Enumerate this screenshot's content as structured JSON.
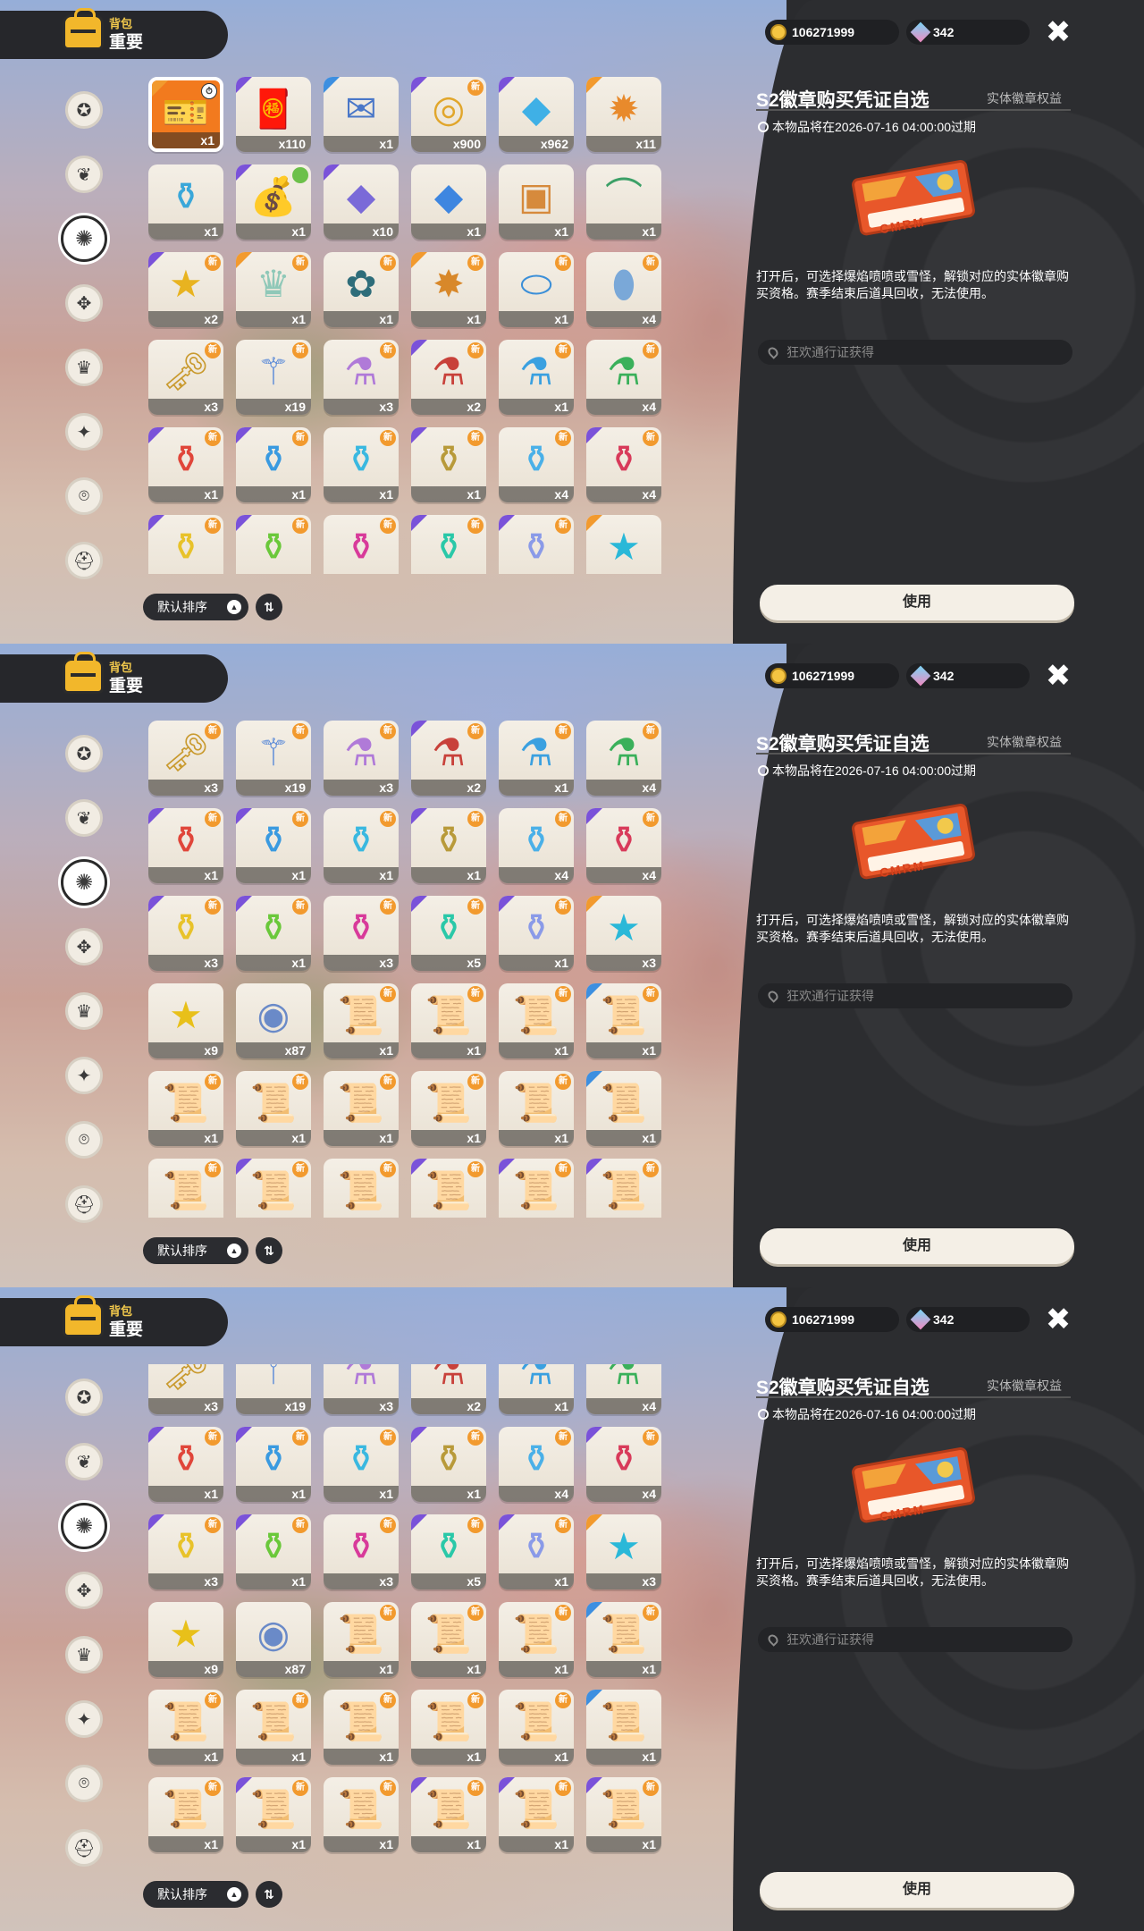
{
  "header": {
    "section": "背包",
    "category": "重要"
  },
  "currency": {
    "coins": "106271999",
    "gems": "342"
  },
  "nav_icons": [
    "star-icon",
    "leaf-icon",
    "badge-icon",
    "feather-icon",
    "crown-icon",
    "ball-icon",
    "acorn-icon",
    "helmet-icon"
  ],
  "nav_active_index": 2,
  "sort": {
    "label": "默认排序",
    "arrow": "▲",
    "order_icon": "⇅"
  },
  "detail": {
    "title": "S2徽章购买凭证自选",
    "tag": "实体徽章权益",
    "expire": "本物品将在2026-07-16 04:00:00过期",
    "ticket_text": "CMRM",
    "description": "打开后，可选择爆焰喷喷或雪怪，解锁对应的实体徽章购买资格。赛季结束后道具回收，无法使用。",
    "source": "狂欢通行证获得",
    "use_label": "使用",
    "close": "✖"
  },
  "new_label": "新",
  "colors": {
    "purple": "#7a52d9",
    "orange": "#f29a2e",
    "blue": "#3d8fe0",
    "accent_selected": "#f27a1e",
    "panel": "#2c2d30"
  },
  "items": [
    {
      "glyph": "🎫",
      "color": "#e0622a",
      "qty": "x1",
      "rarity": "orange",
      "badge": "timer"
    },
    {
      "glyph": "🧧",
      "color": "#c8553a",
      "qty": "x110",
      "rarity": "purple",
      "badge": ""
    },
    {
      "glyph": "✉",
      "color": "#4a77c8",
      "qty": "x1",
      "rarity": "blue",
      "badge": ""
    },
    {
      "glyph": "◎",
      "color": "#e1a62b",
      "qty": "x900",
      "rarity": "purple",
      "badge": "new"
    },
    {
      "glyph": "◆",
      "color": "#3fb0e6",
      "qty": "x962",
      "rarity": "purple",
      "badge": ""
    },
    {
      "glyph": "✹",
      "color": "#e88a2c",
      "qty": "x11",
      "rarity": "orange",
      "badge": ""
    },
    {
      "glyph": "⚱",
      "color": "#3aa7d9",
      "qty": "x1",
      "rarity": "",
      "badge": ""
    },
    {
      "glyph": "💰",
      "color": "#6a4fb3",
      "qty": "x1",
      "rarity": "purple",
      "badge": "green"
    },
    {
      "glyph": "◆",
      "color": "#7a6ad8",
      "qty": "x10",
      "rarity": "purple",
      "badge": ""
    },
    {
      "glyph": "◆",
      "color": "#3e86e0",
      "qty": "x1",
      "rarity": "",
      "badge": ""
    },
    {
      "glyph": "▣",
      "color": "#d68a3c",
      "qty": "x1",
      "rarity": "",
      "badge": ""
    },
    {
      "glyph": "⌒",
      "color": "#3ca067",
      "qty": "x1",
      "rarity": "",
      "badge": ""
    },
    {
      "glyph": "★",
      "color": "#e8b320",
      "qty": "x2",
      "rarity": "purple",
      "badge": "new"
    },
    {
      "glyph": "♛",
      "color": "#8fc8b8",
      "qty": "x1",
      "rarity": "orange",
      "badge": "new"
    },
    {
      "glyph": "✿",
      "color": "#2e6d7a",
      "qty": "x1",
      "rarity": "",
      "badge": "new"
    },
    {
      "glyph": "✸",
      "color": "#d8882a",
      "qty": "x1",
      "rarity": "orange",
      "badge": "new"
    },
    {
      "glyph": "⬭",
      "color": "#3b8fd8",
      "qty": "x1",
      "rarity": "",
      "badge": "new"
    },
    {
      "glyph": "⬮",
      "color": "#7aa8d8",
      "qty": "x4",
      "rarity": "",
      "badge": "new"
    },
    {
      "glyph": "🗝",
      "color": "#c99a2e",
      "qty": "x3",
      "rarity": "",
      "badge": "new"
    },
    {
      "glyph": "⚚",
      "color": "#5a8ad8",
      "qty": "x19",
      "rarity": "",
      "badge": "new"
    },
    {
      "glyph": "⚗",
      "color": "#b07ad8",
      "qty": "x3",
      "rarity": "",
      "badge": "new"
    },
    {
      "glyph": "⚗",
      "color": "#c8413a",
      "qty": "x2",
      "rarity": "purple",
      "badge": "new"
    },
    {
      "glyph": "⚗",
      "color": "#3aa0e0",
      "qty": "x1",
      "rarity": "",
      "badge": "new"
    },
    {
      "glyph": "⚗",
      "color": "#3ab05a",
      "qty": "x4",
      "rarity": "",
      "badge": "new"
    },
    {
      "glyph": "⚱",
      "color": "#e0463a",
      "qty": "x1",
      "rarity": "purple",
      "badge": "new"
    },
    {
      "glyph": "⚱",
      "color": "#3a9ae0",
      "qty": "x1",
      "rarity": "purple",
      "badge": "new"
    },
    {
      "glyph": "⚱",
      "color": "#3ab8e0",
      "qty": "x1",
      "rarity": "",
      "badge": "new"
    },
    {
      "glyph": "⚱",
      "color": "#b89a3a",
      "qty": "x1",
      "rarity": "purple",
      "badge": "new"
    },
    {
      "glyph": "⚱",
      "color": "#4ab0e8",
      "qty": "x4",
      "rarity": "",
      "badge": "new"
    },
    {
      "glyph": "⚱",
      "color": "#d83a5a",
      "qty": "x4",
      "rarity": "purple",
      "badge": "new"
    },
    {
      "glyph": "⚱",
      "color": "#e8c22a",
      "qty": "x3",
      "rarity": "purple",
      "badge": "new"
    },
    {
      "glyph": "⚱",
      "color": "#6ac83a",
      "qty": "x1",
      "rarity": "purple",
      "badge": "new"
    },
    {
      "glyph": "⚱",
      "color": "#d83a9a",
      "qty": "x3",
      "rarity": "",
      "badge": "new"
    },
    {
      "glyph": "⚱",
      "color": "#2ac8a8",
      "qty": "x5",
      "rarity": "purple",
      "badge": "new"
    },
    {
      "glyph": "⚱",
      "color": "#8a9ae8",
      "qty": "x1",
      "rarity": "purple",
      "badge": "new"
    },
    {
      "glyph": "★",
      "color": "#2ab8d8",
      "qty": "x3",
      "rarity": "orange",
      "badge": ""
    },
    {
      "glyph": "★",
      "color": "#e8c01a",
      "qty": "x9",
      "rarity": "",
      "badge": ""
    },
    {
      "glyph": "◉",
      "color": "#6a8ac8",
      "qty": "x87",
      "rarity": "",
      "badge": ""
    },
    {
      "glyph": "📜",
      "color": "#b08a5a",
      "qty": "x1",
      "rarity": "",
      "badge": "new"
    },
    {
      "glyph": "📜",
      "color": "#b08a5a",
      "qty": "x1",
      "rarity": "",
      "badge": "new"
    },
    {
      "glyph": "📜",
      "color": "#b08a5a",
      "qty": "x1",
      "rarity": "",
      "badge": "new"
    },
    {
      "glyph": "📜",
      "color": "#7a8aa8",
      "qty": "x1",
      "rarity": "blue",
      "badge": "new"
    },
    {
      "glyph": "📜",
      "color": "#6aa87a",
      "qty": "x1",
      "rarity": "",
      "badge": "new"
    },
    {
      "glyph": "📜",
      "color": "#d87a6a",
      "qty": "x1",
      "rarity": "",
      "badge": "new"
    },
    {
      "glyph": "📜",
      "color": "#d87a6a",
      "qty": "x1",
      "rarity": "",
      "badge": "new"
    },
    {
      "glyph": "📜",
      "color": "#d87a6a",
      "qty": "x1",
      "rarity": "",
      "badge": "new"
    },
    {
      "glyph": "📜",
      "color": "#d87a6a",
      "qty": "x1",
      "rarity": "",
      "badge": "new"
    },
    {
      "glyph": "📜",
      "color": "#5a8ad8",
      "qty": "x1",
      "rarity": "blue",
      "badge": ""
    },
    {
      "glyph": "📜",
      "color": "#5aa8c8",
      "qty": "x1",
      "rarity": "",
      "badge": "new"
    },
    {
      "glyph": "📜",
      "color": "#d87a6a",
      "qty": "x1",
      "rarity": "purple",
      "badge": "new"
    },
    {
      "glyph": "📜",
      "color": "#c89a4a",
      "qty": "x1",
      "rarity": "",
      "badge": "new"
    },
    {
      "glyph": "📜",
      "color": "#d87a6a",
      "qty": "x1",
      "rarity": "purple",
      "badge": "new"
    },
    {
      "glyph": "📜",
      "color": "#8a5ac8",
      "qty": "x1",
      "rarity": "purple",
      "badge": "new"
    },
    {
      "glyph": "📜",
      "color": "#b85ab8",
      "qty": "x1",
      "rarity": "purple",
      "badge": "new"
    }
  ]
}
